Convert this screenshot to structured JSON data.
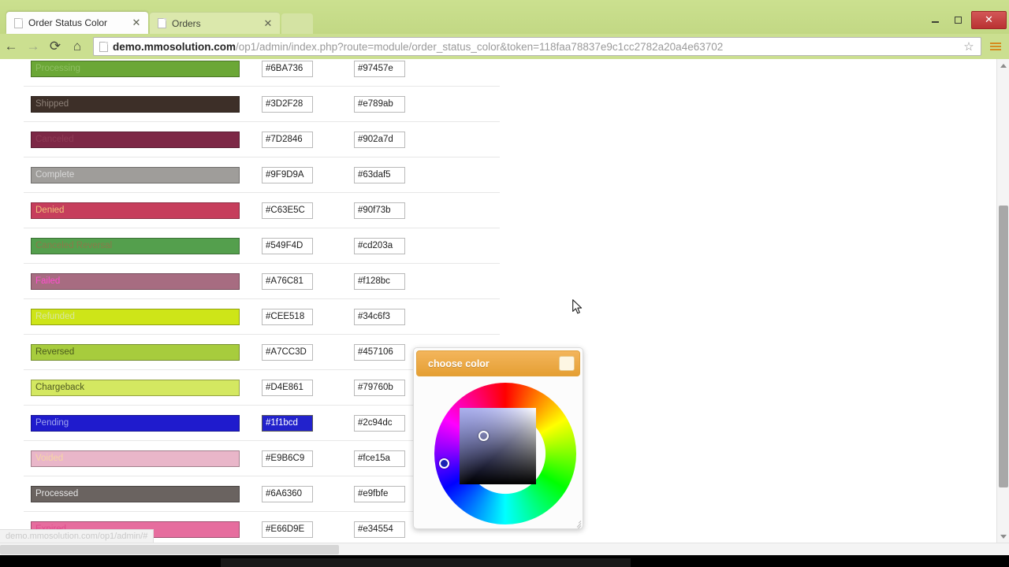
{
  "window": {
    "minimize_label": "–",
    "maximize_label": "❐",
    "close_label": "✕"
  },
  "tabs": [
    {
      "title": "Order Status Color",
      "close_label": "✕",
      "active": true
    },
    {
      "title": "Orders",
      "close_label": "✕",
      "active": false
    }
  ],
  "toolbar": {
    "back_label": "←",
    "forward_label": "→",
    "reload_label": "⟳",
    "home_label": "⌂",
    "star_label": "☆",
    "menu_label": "menu-icon",
    "url_domain": "demo.mmosolution.com",
    "url_path": "/op1/admin/index.php?route=module/order_status_color&token=118faa78837e9c1cc2782a20a4e63702",
    "url_full": "demo.mmosolution.com/op1/admin/index.php?route=module/order_status_color&token=118faa78837e9c1cc2782a20a4e63702"
  },
  "status_bar": {
    "text": "demo.mmosolution.com/op1/admin/#"
  },
  "table": {
    "rows": [
      {
        "label": "Processing",
        "bar_color": "#6BA736",
        "text_color": "#8fbf63",
        "hex_primary": "#6BA736",
        "hex_secondary": "#97457e",
        "selected": false
      },
      {
        "label": "Shipped",
        "bar_color": "#3D2F28",
        "text_color": "#8d8078",
        "hex_primary": "#3D2F28",
        "hex_secondary": "#e789ab",
        "selected": false
      },
      {
        "label": "Canceled",
        "bar_color": "#7D2846",
        "text_color": "#8e3b56",
        "hex_primary": "#7D2846",
        "hex_secondary": "#902a7d",
        "selected": false
      },
      {
        "label": "Complete",
        "bar_color": "#9F9D9A",
        "text_color": "#d9d9d9",
        "hex_primary": "#9F9D9A",
        "hex_secondary": "#63daf5",
        "selected": false
      },
      {
        "label": "Denied",
        "bar_color": "#C63E5C",
        "text_color": "#f0c27a",
        "hex_primary": "#C63E5C",
        "hex_secondary": "#90f73b",
        "selected": false
      },
      {
        "label": "Canceled Reversal",
        "bar_color": "#549F4D",
        "text_color": "#8a7a4a",
        "hex_primary": "#549F4D",
        "hex_secondary": "#cd203a",
        "selected": false
      },
      {
        "label": "Failed",
        "bar_color": "#A76C81",
        "text_color": "#ff4fd0",
        "hex_primary": "#A76C81",
        "hex_secondary": "#f128bc",
        "selected": false
      },
      {
        "label": "Refunded",
        "bar_color": "#CEE518",
        "text_color": "#d8e6a0",
        "hex_primary": "#CEE518",
        "hex_secondary": "#34c6f3",
        "selected": false
      },
      {
        "label": "Reversed",
        "bar_color": "#A7CC3D",
        "text_color": "#4b5b1d",
        "hex_primary": "#A7CC3D",
        "hex_secondary": "#457106",
        "selected": false
      },
      {
        "label": "Chargeback",
        "bar_color": "#D4E861",
        "text_color": "#4f5a22",
        "hex_primary": "#D4E861",
        "hex_secondary": "#79760b",
        "selected": false
      },
      {
        "label": "Pending",
        "bar_color": "#1f1bcd",
        "text_color": "#9fa4ee",
        "hex_primary": "#1f1bcd",
        "hex_secondary": "#2c94dc",
        "selected": true
      },
      {
        "label": "Voided",
        "bar_color": "#E9B6C9",
        "text_color": "#f6d6a4",
        "hex_primary": "#E9B6C9",
        "hex_secondary": "#fce15a",
        "selected": false
      },
      {
        "label": "Processed",
        "bar_color": "#6A6360",
        "text_color": "#e6e6e6",
        "hex_primary": "#6A6360",
        "hex_secondary": "#e9fbfe",
        "selected": false
      },
      {
        "label": "Expired",
        "bar_color": "#E66D9E",
        "text_color": "#e04b8d",
        "hex_primary": "#E66D9E",
        "hex_secondary": "#e34554",
        "selected": false
      }
    ]
  },
  "color_picker": {
    "title": "choose color",
    "close_label": "",
    "wheel_selected_color": "#1922b4",
    "square_selected_color": "#5a6bb5",
    "accent": "#e8a33d"
  }
}
